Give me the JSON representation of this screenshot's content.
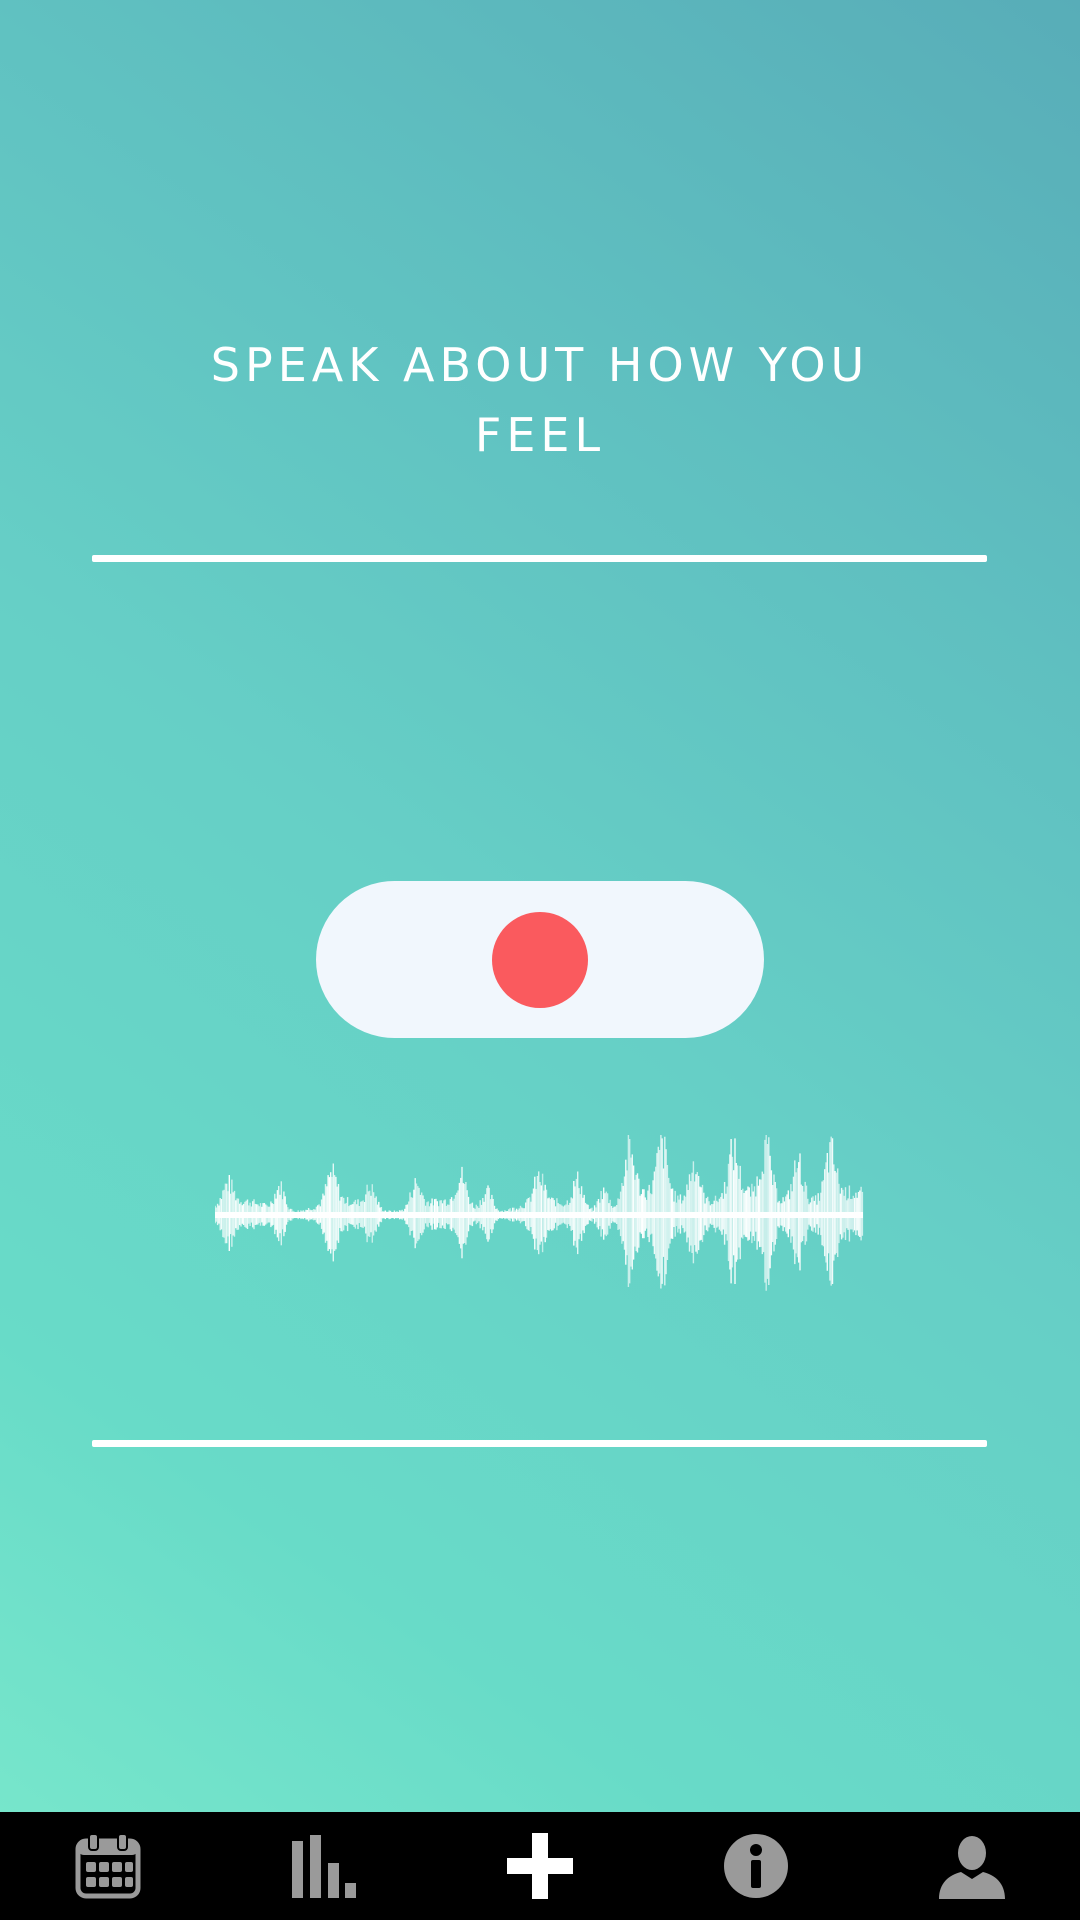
{
  "screen": {
    "prompt": "SPEAK ABOUT HOW YOU FEEL"
  },
  "record_button": {
    "state": "idle",
    "dot_color": "#fa5a5e",
    "pill_color": "#f1f7fd"
  },
  "waveform": {
    "color": "#ffffff"
  },
  "tabbar": {
    "background": "#000000",
    "active_color": "#ffffff",
    "inactive_color": "#9a9a9a",
    "tabs": [
      {
        "icon": "calendar-icon",
        "active": false
      },
      {
        "icon": "bar-chart-icon",
        "active": false
      },
      {
        "icon": "plus-icon",
        "active": true
      },
      {
        "icon": "info-icon",
        "active": false
      },
      {
        "icon": "user-icon",
        "active": false
      }
    ]
  }
}
